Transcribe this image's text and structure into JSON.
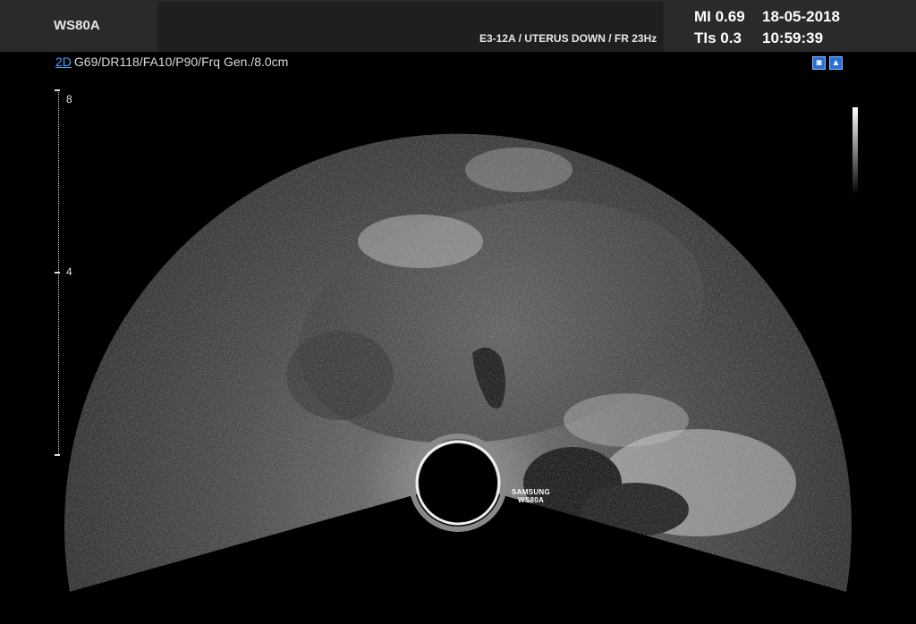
{
  "header": {
    "brand": "WS80A",
    "probe_info": "E3-12A / UTERUS DOWN / FR 23Hz",
    "mi": "MI  0.69",
    "tis": "TIs 0.3",
    "date": "18-05-2018",
    "time": "10:59:39"
  },
  "params": {
    "mode": "2D",
    "settings": "G69/DR118/FA10/P90/Frq Gen./8.0cm"
  },
  "scale": {
    "top_label": "8",
    "mid_label": "4"
  },
  "watermark": {
    "line1": "SAMSUNG",
    "line2": "WS80A"
  },
  "icons": [
    "camera-icon",
    "report-icon"
  ]
}
